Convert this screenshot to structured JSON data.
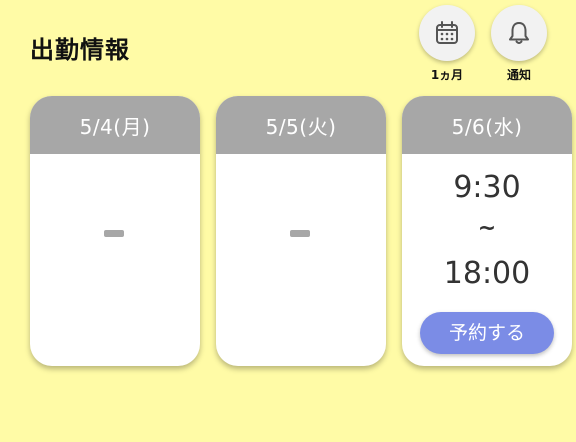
{
  "header": {
    "title": "出勤情報",
    "month_button_label": "1ヵ月",
    "notify_button_label": "通知"
  },
  "icons": {
    "month": "calendar-icon",
    "notify": "bell-icon"
  },
  "days": [
    {
      "date_label": "5/4(月)",
      "status": "-"
    },
    {
      "date_label": "5/5(火)",
      "status": "-"
    },
    {
      "date_label": "5/6(水)",
      "start": "9:30",
      "separator": "~",
      "end": "18:00",
      "reserve_label": "予約する"
    }
  ],
  "colors": {
    "background": "#fffba6",
    "card_header": "#a7a7a7",
    "reserve_button": "#7b8ce6"
  }
}
